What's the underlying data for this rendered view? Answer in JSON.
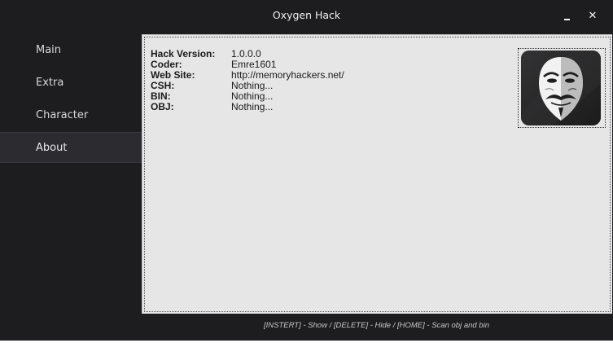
{
  "window": {
    "title": "Oxygen Hack",
    "minimize_icon": "minimize-icon",
    "close_icon": "close-icon",
    "close_glyph": "✕"
  },
  "sidebar": {
    "items": [
      {
        "label": "Main",
        "active": false
      },
      {
        "label": "Extra",
        "active": false
      },
      {
        "label": "Character",
        "active": false
      },
      {
        "label": "About",
        "active": true
      }
    ]
  },
  "about": {
    "rows": [
      {
        "key": "Hack Version:",
        "value": "1.0.0.0"
      },
      {
        "key": "Coder:",
        "value": "Emre1601"
      },
      {
        "key": "Web Site:",
        "value": "http://memoryhackers.net/"
      },
      {
        "key": "CSH:",
        "value": "Nothing..."
      },
      {
        "key": "BIN:",
        "value": "Nothing..."
      },
      {
        "key": "OBJ:",
        "value": "Nothing..."
      }
    ],
    "avatar_icon": "anonymous-mask-icon"
  },
  "status_bar": {
    "text": "[INSTERT] - Show / [DELETE] - Hide / [HOME] - Scan obj and bin"
  },
  "colors": {
    "window_bg": "#1d1d1f",
    "active_item_bg": "#2c2c30",
    "panel_bg": "#e6e6e6"
  }
}
